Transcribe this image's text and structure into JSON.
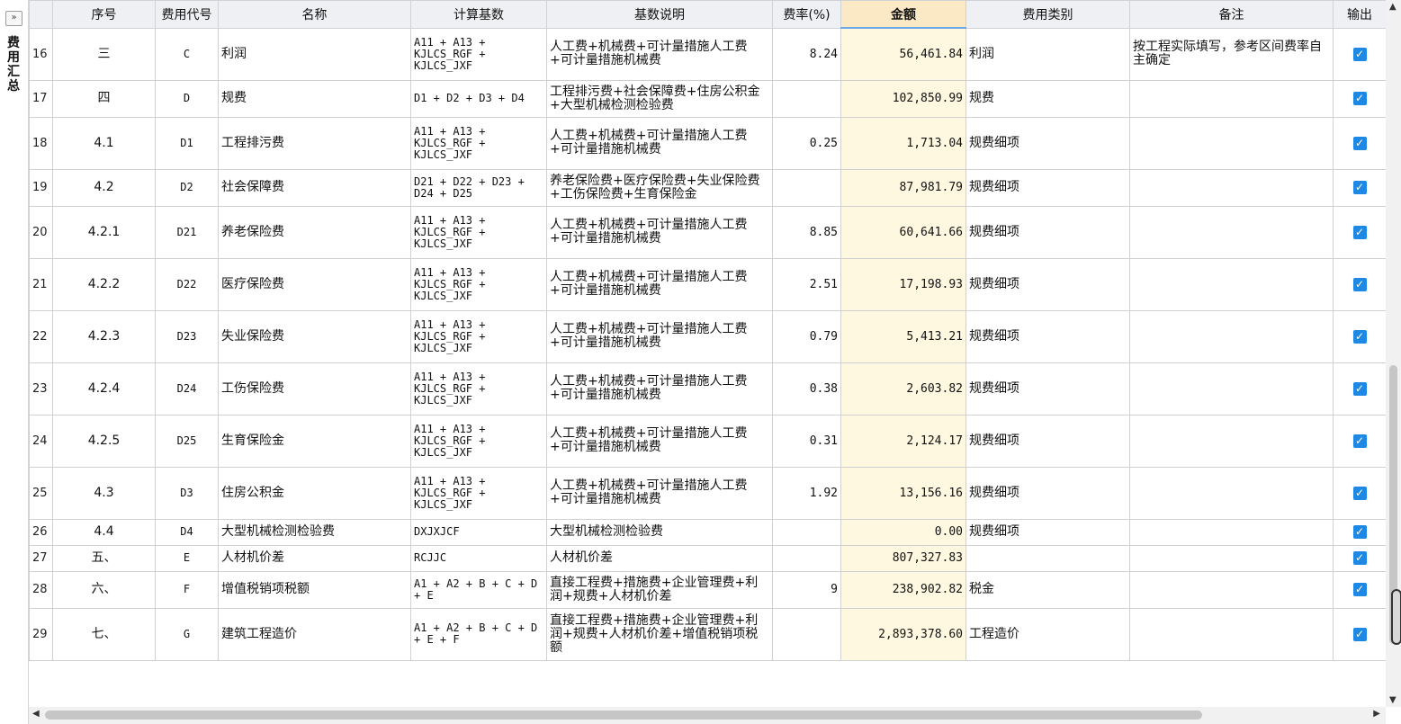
{
  "side_panel": {
    "collapse_label": "»",
    "title": "费用汇总"
  },
  "columns": [
    "",
    "序号",
    "费用代号",
    "名称",
    "计算基数",
    "基数说明",
    "费率(%)",
    "金额",
    "费用类别",
    "备注",
    "输出"
  ],
  "rows": [
    {
      "idx": "16",
      "seq": "三",
      "code": "C",
      "name": "利润",
      "base": "A11 + A13 + KJLCS_RGF + KJLCS_JXF",
      "desc": "人工费+机械费+可计量措施人工费+可计量措施机械费",
      "rate": "8.24",
      "amount": "56,461.84",
      "category": "利润",
      "note": "按工程实际填写，参考区间费率自主确定",
      "output": true
    },
    {
      "idx": "17",
      "seq": "四",
      "code": "D",
      "name": "规费",
      "base": "D1 + D2 + D3 + D4",
      "desc": "工程排污费+社会保障费+住房公积金+大型机械检测检验费",
      "rate": "",
      "amount": "102,850.99",
      "category": "规费",
      "note": "",
      "output": true
    },
    {
      "idx": "18",
      "seq": "4.1",
      "code": "D1",
      "name": "工程排污费",
      "base": "A11 + A13 + KJLCS_RGF + KJLCS_JXF",
      "desc": "人工费+机械费+可计量措施人工费+可计量措施机械费",
      "rate": "0.25",
      "amount": "1,713.04",
      "category": "规费细项",
      "note": "",
      "output": true
    },
    {
      "idx": "19",
      "seq": "4.2",
      "code": "D2",
      "name": "社会保障费",
      "base": "D21 + D22 + D23 + D24 + D25",
      "desc": "养老保险费+医疗保险费+失业保险费+工伤保险费+生育保险金",
      "rate": "",
      "amount": "87,981.79",
      "category": "规费细项",
      "note": "",
      "output": true
    },
    {
      "idx": "20",
      "seq": "4.2.1",
      "code": "D21",
      "name": "养老保险费",
      "base": "A11 + A13 + KJLCS_RGF + KJLCS_JXF",
      "desc": "人工费+机械费+可计量措施人工费+可计量措施机械费",
      "rate": "8.85",
      "amount": "60,641.66",
      "category": "规费细项",
      "note": "",
      "output": true
    },
    {
      "idx": "21",
      "seq": "4.2.2",
      "code": "D22",
      "name": "医疗保险费",
      "base": "A11 + A13 + KJLCS_RGF + KJLCS_JXF",
      "desc": "人工费+机械费+可计量措施人工费+可计量措施机械费",
      "rate": "2.51",
      "amount": "17,198.93",
      "category": "规费细项",
      "note": "",
      "output": true
    },
    {
      "idx": "22",
      "seq": "4.2.3",
      "code": "D23",
      "name": "失业保险费",
      "base": "A11 + A13 + KJLCS_RGF + KJLCS_JXF",
      "desc": "人工费+机械费+可计量措施人工费+可计量措施机械费",
      "rate": "0.79",
      "amount": "5,413.21",
      "category": "规费细项",
      "note": "",
      "output": true
    },
    {
      "idx": "23",
      "seq": "4.2.4",
      "code": "D24",
      "name": "工伤保险费",
      "base": "A11 + A13 + KJLCS_RGF + KJLCS_JXF",
      "desc": "人工费+机械费+可计量措施人工费+可计量措施机械费",
      "rate": "0.38",
      "amount": "2,603.82",
      "category": "规费细项",
      "note": "",
      "output": true
    },
    {
      "idx": "24",
      "seq": "4.2.5",
      "code": "D25",
      "name": "生育保险金",
      "base": "A11 + A13 + KJLCS_RGF + KJLCS_JXF",
      "desc": "人工费+机械费+可计量措施人工费+可计量措施机械费",
      "rate": "0.31",
      "amount": "2,124.17",
      "category": "规费细项",
      "note": "",
      "output": true
    },
    {
      "idx": "25",
      "seq": "4.3",
      "code": "D3",
      "name": "住房公积金",
      "base": "A11 + A13 + KJLCS_RGF + KJLCS_JXF",
      "desc": "人工费+机械费+可计量措施人工费+可计量措施机械费",
      "rate": "1.92",
      "amount": "13,156.16",
      "category": "规费细项",
      "note": "",
      "output": true
    },
    {
      "idx": "26",
      "seq": "4.4",
      "code": "D4",
      "name": "大型机械检测检验费",
      "base": "DXJXJCF",
      "desc": "大型机械检测检验费",
      "rate": "",
      "amount": "0.00",
      "category": "规费细项",
      "note": "",
      "output": true
    },
    {
      "idx": "27",
      "seq": "五、",
      "code": "E",
      "name": "人材机价差",
      "base": "RCJJC",
      "desc": "人材机价差",
      "rate": "",
      "amount": "807,327.83",
      "category": "",
      "note": "",
      "output": true
    },
    {
      "idx": "28",
      "seq": "六、",
      "code": "F",
      "name": "增值税销项税额",
      "base": "A1 + A2 + B + C + D + E",
      "desc": "直接工程费+措施费+企业管理费+利润+规费+人材机价差",
      "rate": "9",
      "amount": "238,902.82",
      "category": "税金",
      "note": "",
      "output": true
    },
    {
      "idx": "29",
      "seq": "七、",
      "code": "G",
      "name": "建筑工程造价",
      "base": "A1 + A2 + B + C + D + E + F",
      "desc": "直接工程费+措施费+企业管理费+利润+规费+人材机价差+增值税销项税额",
      "rate": "",
      "amount": "2,893,378.60",
      "category": "工程造价",
      "note": "",
      "output": true
    }
  ],
  "colors": {
    "header_bg": "#eef0f3",
    "amount_header_bg": "#fbe8c4",
    "amount_cell_bg": "#fff8e0",
    "checkbox": "#1e88e5"
  }
}
